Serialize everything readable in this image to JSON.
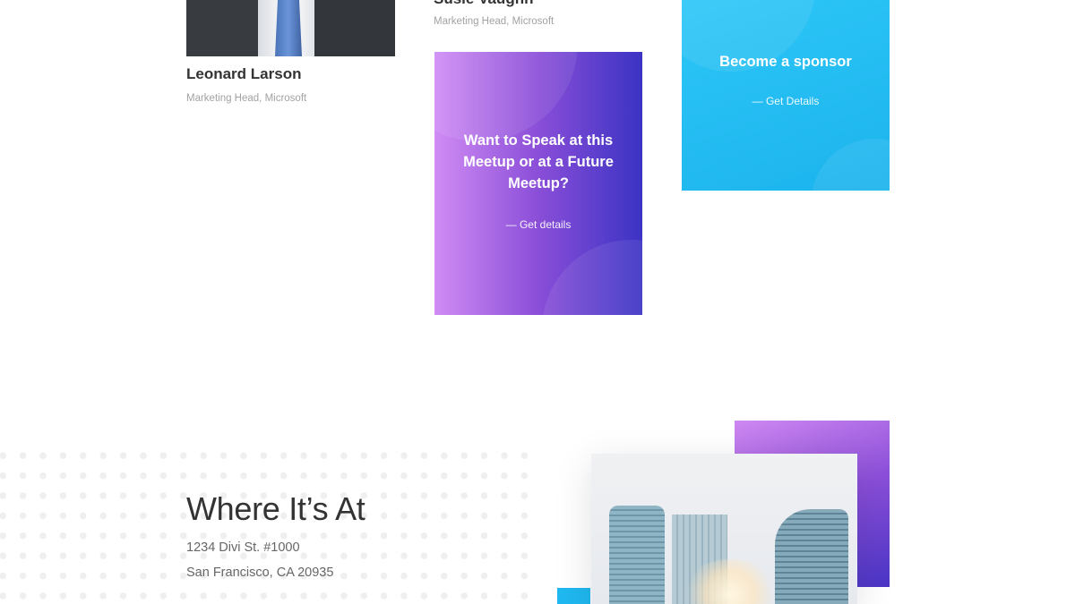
{
  "speakers": [
    {
      "name": "Leonard Larson",
      "role": "Marketing Head, Microsoft"
    },
    {
      "name": "Susie Vaughn",
      "role": "Marketing Head, Microsoft"
    }
  ],
  "cta_speak": {
    "title": "Want to Speak at this Meetup or at a Future Meetup?",
    "link": "— Get details"
  },
  "cta_sponsor": {
    "title": "Become a sponsor",
    "link": "— Get Details"
  },
  "location": {
    "title": "Where It’s At",
    "address_line1": "1234 Divi St. #1000",
    "address_line2": "San Francisco, CA 20935"
  },
  "colors": {
    "purple_gradient_start": "#d08cf4",
    "purple_gradient_end": "#3b33c4",
    "cyan": "#1fb8f0",
    "heading": "#333333",
    "muted": "#a2a2a2"
  }
}
